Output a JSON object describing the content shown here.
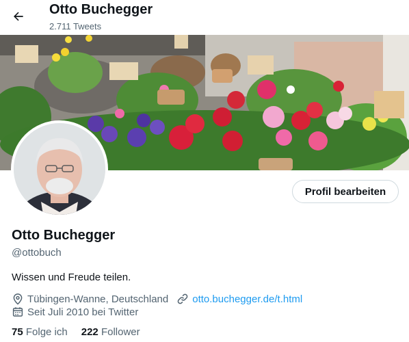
{
  "header": {
    "title": "Otto Buchegger",
    "tweet_count": "2.711 Tweets"
  },
  "profile": {
    "edit_button_label": "Profil bearbeiten",
    "name": "Otto Buchegger",
    "handle": "@ottobuch",
    "bio": "Wissen und Freude teilen.",
    "location": "Tübingen-Wanne, Deutschland",
    "website": "otto.buchegger.de/t.html",
    "joined": "Seit Juli 2010 bei Twitter",
    "following_count": "75",
    "following_label": "Folge ich",
    "followers_count": "222",
    "followers_label": "Follower"
  },
  "colors": {
    "link": "#1d9bf0",
    "secondary_text": "#536471",
    "primary_text": "#0f1419"
  },
  "icons": {
    "back": "arrow-left-icon",
    "location": "location-pin-icon",
    "link": "link-icon",
    "calendar": "calendar-icon"
  }
}
